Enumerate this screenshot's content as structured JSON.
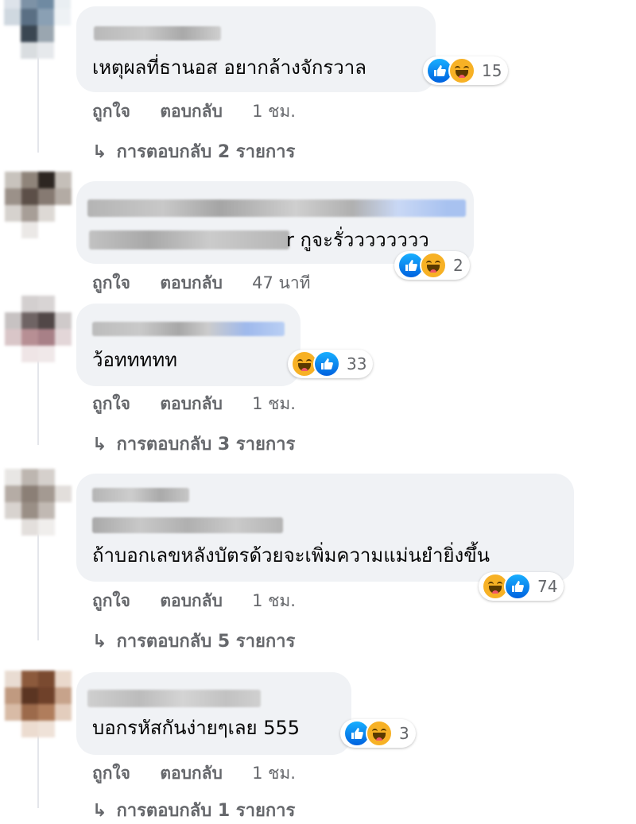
{
  "comments": [
    {
      "text": "เหตุผลที่ธานอส อยากล้างจักรวาล",
      "reaction_count": "15",
      "like_label": "ถูกใจ",
      "reply_label": "ตอบกลับ",
      "time": "1 ชม.",
      "replies_link": "การตอบกลับ 2 รายการ"
    },
    {
      "text": "r กูจะรั่วววววววว",
      "reaction_count": "2",
      "like_label": "ถูกใจ",
      "reply_label": "ตอบกลับ",
      "time": "47 นาที"
    },
    {
      "text": "ว้อททททท",
      "reaction_count": "33",
      "like_label": "ถูกใจ",
      "reply_label": "ตอบกลับ",
      "time": "1 ชม.",
      "replies_link": "การตอบกลับ 3 รายการ"
    },
    {
      "text": "ถ้าบอกเลขหลังบัตรด้วยจะเพิ่มความแม่นยำยิ่งขึ้น",
      "reaction_count": "74",
      "like_label": "ถูกใจ",
      "reply_label": "ตอบกลับ",
      "time": "1 ชม.",
      "replies_link": "การตอบกลับ 5 รายการ"
    },
    {
      "text": "บอกรหัสกันง่ายๆเลย 555",
      "reaction_count": "3",
      "like_label": "ถูกใจ",
      "reply_label": "ตอบกลับ",
      "time": "1 ชม.",
      "replies_link": "การตอบกลับ 1 รายการ"
    }
  ],
  "colors": {
    "bubble": "#f0f2f5",
    "meta_text": "#65676b",
    "like_blue": "#1877f2",
    "haha_yellow": "#f7b125"
  },
  "icons": {
    "like": "like-reaction-icon",
    "haha": "haha-reaction-icon",
    "reply_arrow": "reply-arrow-icon"
  }
}
